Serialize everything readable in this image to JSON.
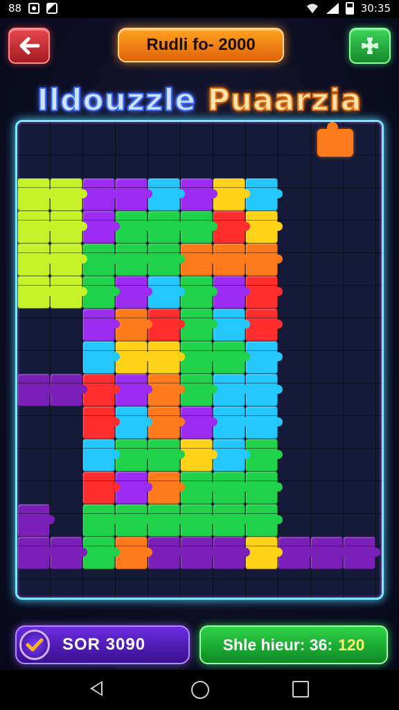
{
  "status_bar": {
    "left_text": "88",
    "time": "30:35"
  },
  "header": {
    "back_icon": "arrow-left-icon",
    "title_pill": "Rudli fo- 2000",
    "right_icon": "puzzle-piece-icon",
    "logo_part1": "Ildouzzle",
    "logo_part2": "Puaarzia"
  },
  "board": {
    "frame_color": "#7fe7ff",
    "piece_colors": [
      "#c7f22a",
      "#9b2cf0",
      "#1fd24a",
      "#24c8ff",
      "#ff7a1a",
      "#ff2d2d",
      "#ffd21a",
      "#7a1fb8"
    ]
  },
  "footer": {
    "score_icon": "check-icon",
    "score_text": "SOR 3090",
    "best_label": "Shle hieur: 36:",
    "best_value": "120"
  },
  "navigation": {
    "back": "nav-back-icon",
    "home": "nav-home-icon",
    "recent": "nav-recent-icon"
  }
}
